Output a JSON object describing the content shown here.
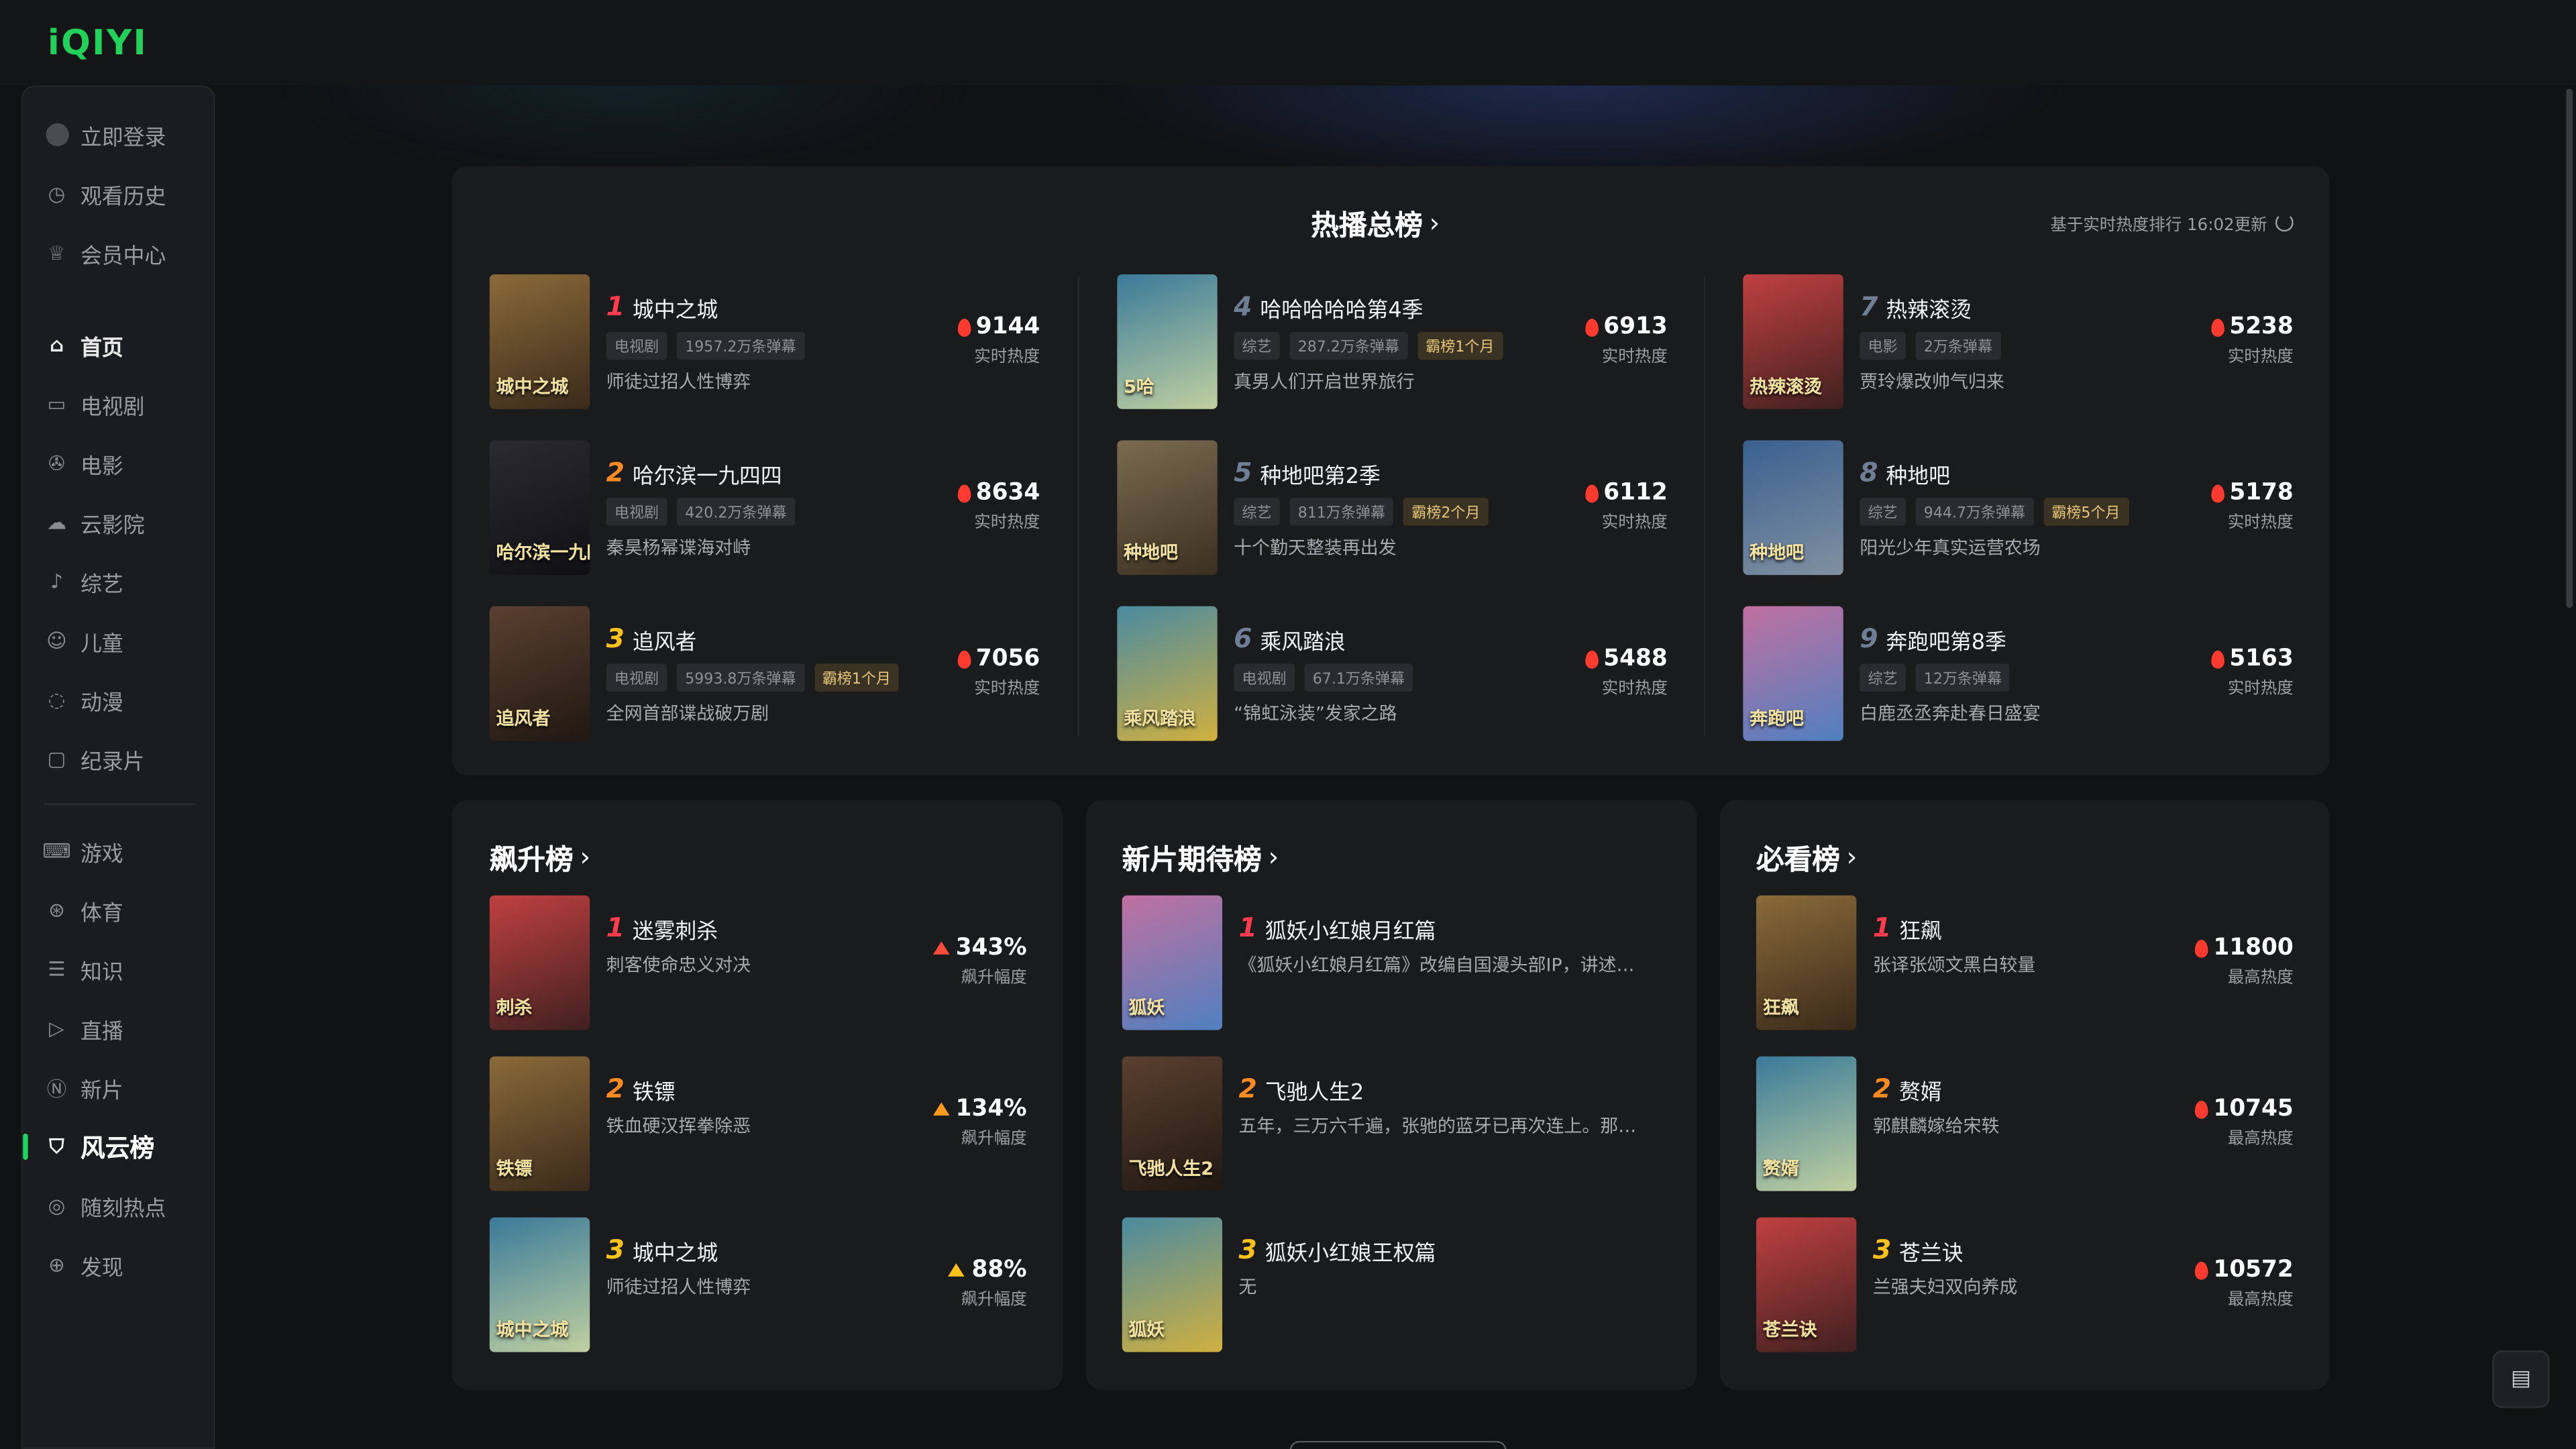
{
  "app": {
    "logo": "iQIYI"
  },
  "colors": {
    "accent": "#1ed760",
    "rank1": "#ff3b4e",
    "rank2": "#ff8a1f",
    "rank3": "#ffc21a",
    "rankOther": "#6f7d95"
  },
  "sidebar": {
    "top": [
      {
        "icon": "avatar-icon",
        "label": "立即登录"
      },
      {
        "icon": "history-icon",
        "label": "观看历史"
      },
      {
        "icon": "vip-icon",
        "label": "会员中心"
      }
    ],
    "nav": [
      {
        "icon": "home-icon",
        "label": "首页"
      },
      {
        "icon": "tv-icon",
        "label": "电视剧"
      },
      {
        "icon": "film-icon",
        "label": "电影"
      },
      {
        "icon": "cloud-icon",
        "label": "云影院"
      },
      {
        "icon": "mic-icon",
        "label": "综艺"
      },
      {
        "icon": "kids-icon",
        "label": "儿童"
      },
      {
        "icon": "anime-icon",
        "label": "动漫"
      },
      {
        "icon": "doc-icon",
        "label": "纪录片"
      }
    ],
    "more": [
      {
        "icon": "game-icon",
        "label": "游戏"
      },
      {
        "icon": "sports-icon",
        "label": "体育"
      },
      {
        "icon": "knowledge-icon",
        "label": "知识"
      },
      {
        "icon": "live-icon",
        "label": "直播"
      },
      {
        "icon": "new-icon",
        "label": "新片"
      },
      {
        "icon": "chart-icon",
        "label": "风云榜"
      },
      {
        "icon": "hot-icon",
        "label": "随刻热点"
      },
      {
        "icon": "discover-icon",
        "label": "发现"
      }
    ]
  },
  "hot": {
    "title": "热播总榜",
    "update": "基于实时热度排行 16:02更新",
    "heat_label": "实时热度",
    "items": [
      {
        "rank": "1",
        "title": "城中之城",
        "tags": [
          "电视剧",
          "1957.2万条弹幕"
        ],
        "gold": "",
        "desc": "师徒过招人性博弈",
        "heat": "9144",
        "poster": "城中之城"
      },
      {
        "rank": "2",
        "title": "哈尔滨一九四四",
        "tags": [
          "电视剧",
          "420.2万条弹幕"
        ],
        "gold": "",
        "desc": "秦昊杨幂谍海对峙",
        "heat": "8634",
        "poster": "哈尔滨一九四四"
      },
      {
        "rank": "3",
        "title": "追风者",
        "tags": [
          "电视剧",
          "5993.8万条弹幕"
        ],
        "gold": "霸榜1个月",
        "desc": "全网首部谍战破万剧",
        "heat": "7056",
        "poster": "追风者"
      },
      {
        "rank": "4",
        "title": "哈哈哈哈哈第4季",
        "tags": [
          "综艺",
          "287.2万条弹幕"
        ],
        "gold": "霸榜1个月",
        "desc": "真男人们开启世界旅行",
        "heat": "6913",
        "poster": "5哈"
      },
      {
        "rank": "5",
        "title": "种地吧第2季",
        "tags": [
          "综艺",
          "811万条弹幕"
        ],
        "gold": "霸榜2个月",
        "desc": "十个勤天整装再出发",
        "heat": "6112",
        "poster": "种地吧"
      },
      {
        "rank": "6",
        "title": "乘风踏浪",
        "tags": [
          "电视剧",
          "67.1万条弹幕"
        ],
        "gold": "",
        "desc": "“锦虹泳装”发家之路",
        "heat": "5488",
        "poster": "乘风踏浪"
      },
      {
        "rank": "7",
        "title": "热辣滚烫",
        "tags": [
          "电影",
          "2万条弹幕"
        ],
        "gold": "",
        "desc": "贾玲爆改帅气归来",
        "heat": "5238",
        "poster": "热辣滚烫"
      },
      {
        "rank": "8",
        "title": "种地吧",
        "tags": [
          "综艺",
          "944.7万条弹幕"
        ],
        "gold": "霸榜5个月",
        "desc": "阳光少年真实运营农场",
        "heat": "5178",
        "poster": "种地吧"
      },
      {
        "rank": "9",
        "title": "奔跑吧第8季",
        "tags": [
          "综艺",
          "12万条弹幕"
        ],
        "gold": "",
        "desc": "白鹿丞丞奔赴春日盛宴",
        "heat": "5163",
        "poster": "奔跑吧"
      }
    ]
  },
  "rising": {
    "title": "飙升榜",
    "label": "飙升幅度",
    "items": [
      {
        "rank": "1",
        "title": "迷雾刺杀",
        "desc": "刺客使命忠义对决",
        "value": "343%",
        "poster": "刺杀"
      },
      {
        "rank": "2",
        "title": "铁镖",
        "desc": "铁血硬汉挥拳除恶",
        "value": "134%",
        "poster": "铁镖"
      },
      {
        "rank": "3",
        "title": "城中之城",
        "desc": "师徒过招人性博弈",
        "value": "88%",
        "poster": "城中之城"
      }
    ]
  },
  "upcoming": {
    "title": "新片期待榜",
    "items": [
      {
        "rank": "1",
        "title": "狐妖小红娘月红篇",
        "desc": "《狐妖小红娘月红篇》改编自国漫头部IP，讲述…",
        "poster": "狐妖"
      },
      {
        "rank": "2",
        "title": "飞驰人生2",
        "desc": "五年，三万六千遍，张驰的蓝牙已再次连上。那…",
        "poster": "飞驰人生2"
      },
      {
        "rank": "3",
        "title": "狐妖小红娘王权篇",
        "desc": "无",
        "poster": "狐妖"
      }
    ]
  },
  "mustwatch": {
    "title": "必看榜",
    "label": "最高热度",
    "items": [
      {
        "rank": "1",
        "title": "狂飙",
        "desc": "张译张颂文黑白较量",
        "value": "11800",
        "poster": "狂飙"
      },
      {
        "rank": "2",
        "title": "赘婿",
        "desc": "郭麒麟嫁给宋轶",
        "value": "10745",
        "poster": "赘婿"
      },
      {
        "rank": "3",
        "title": "苍兰诀",
        "desc": "兰强夫妇双向养成",
        "value": "10572",
        "poster": "苍兰诀"
      }
    ]
  }
}
